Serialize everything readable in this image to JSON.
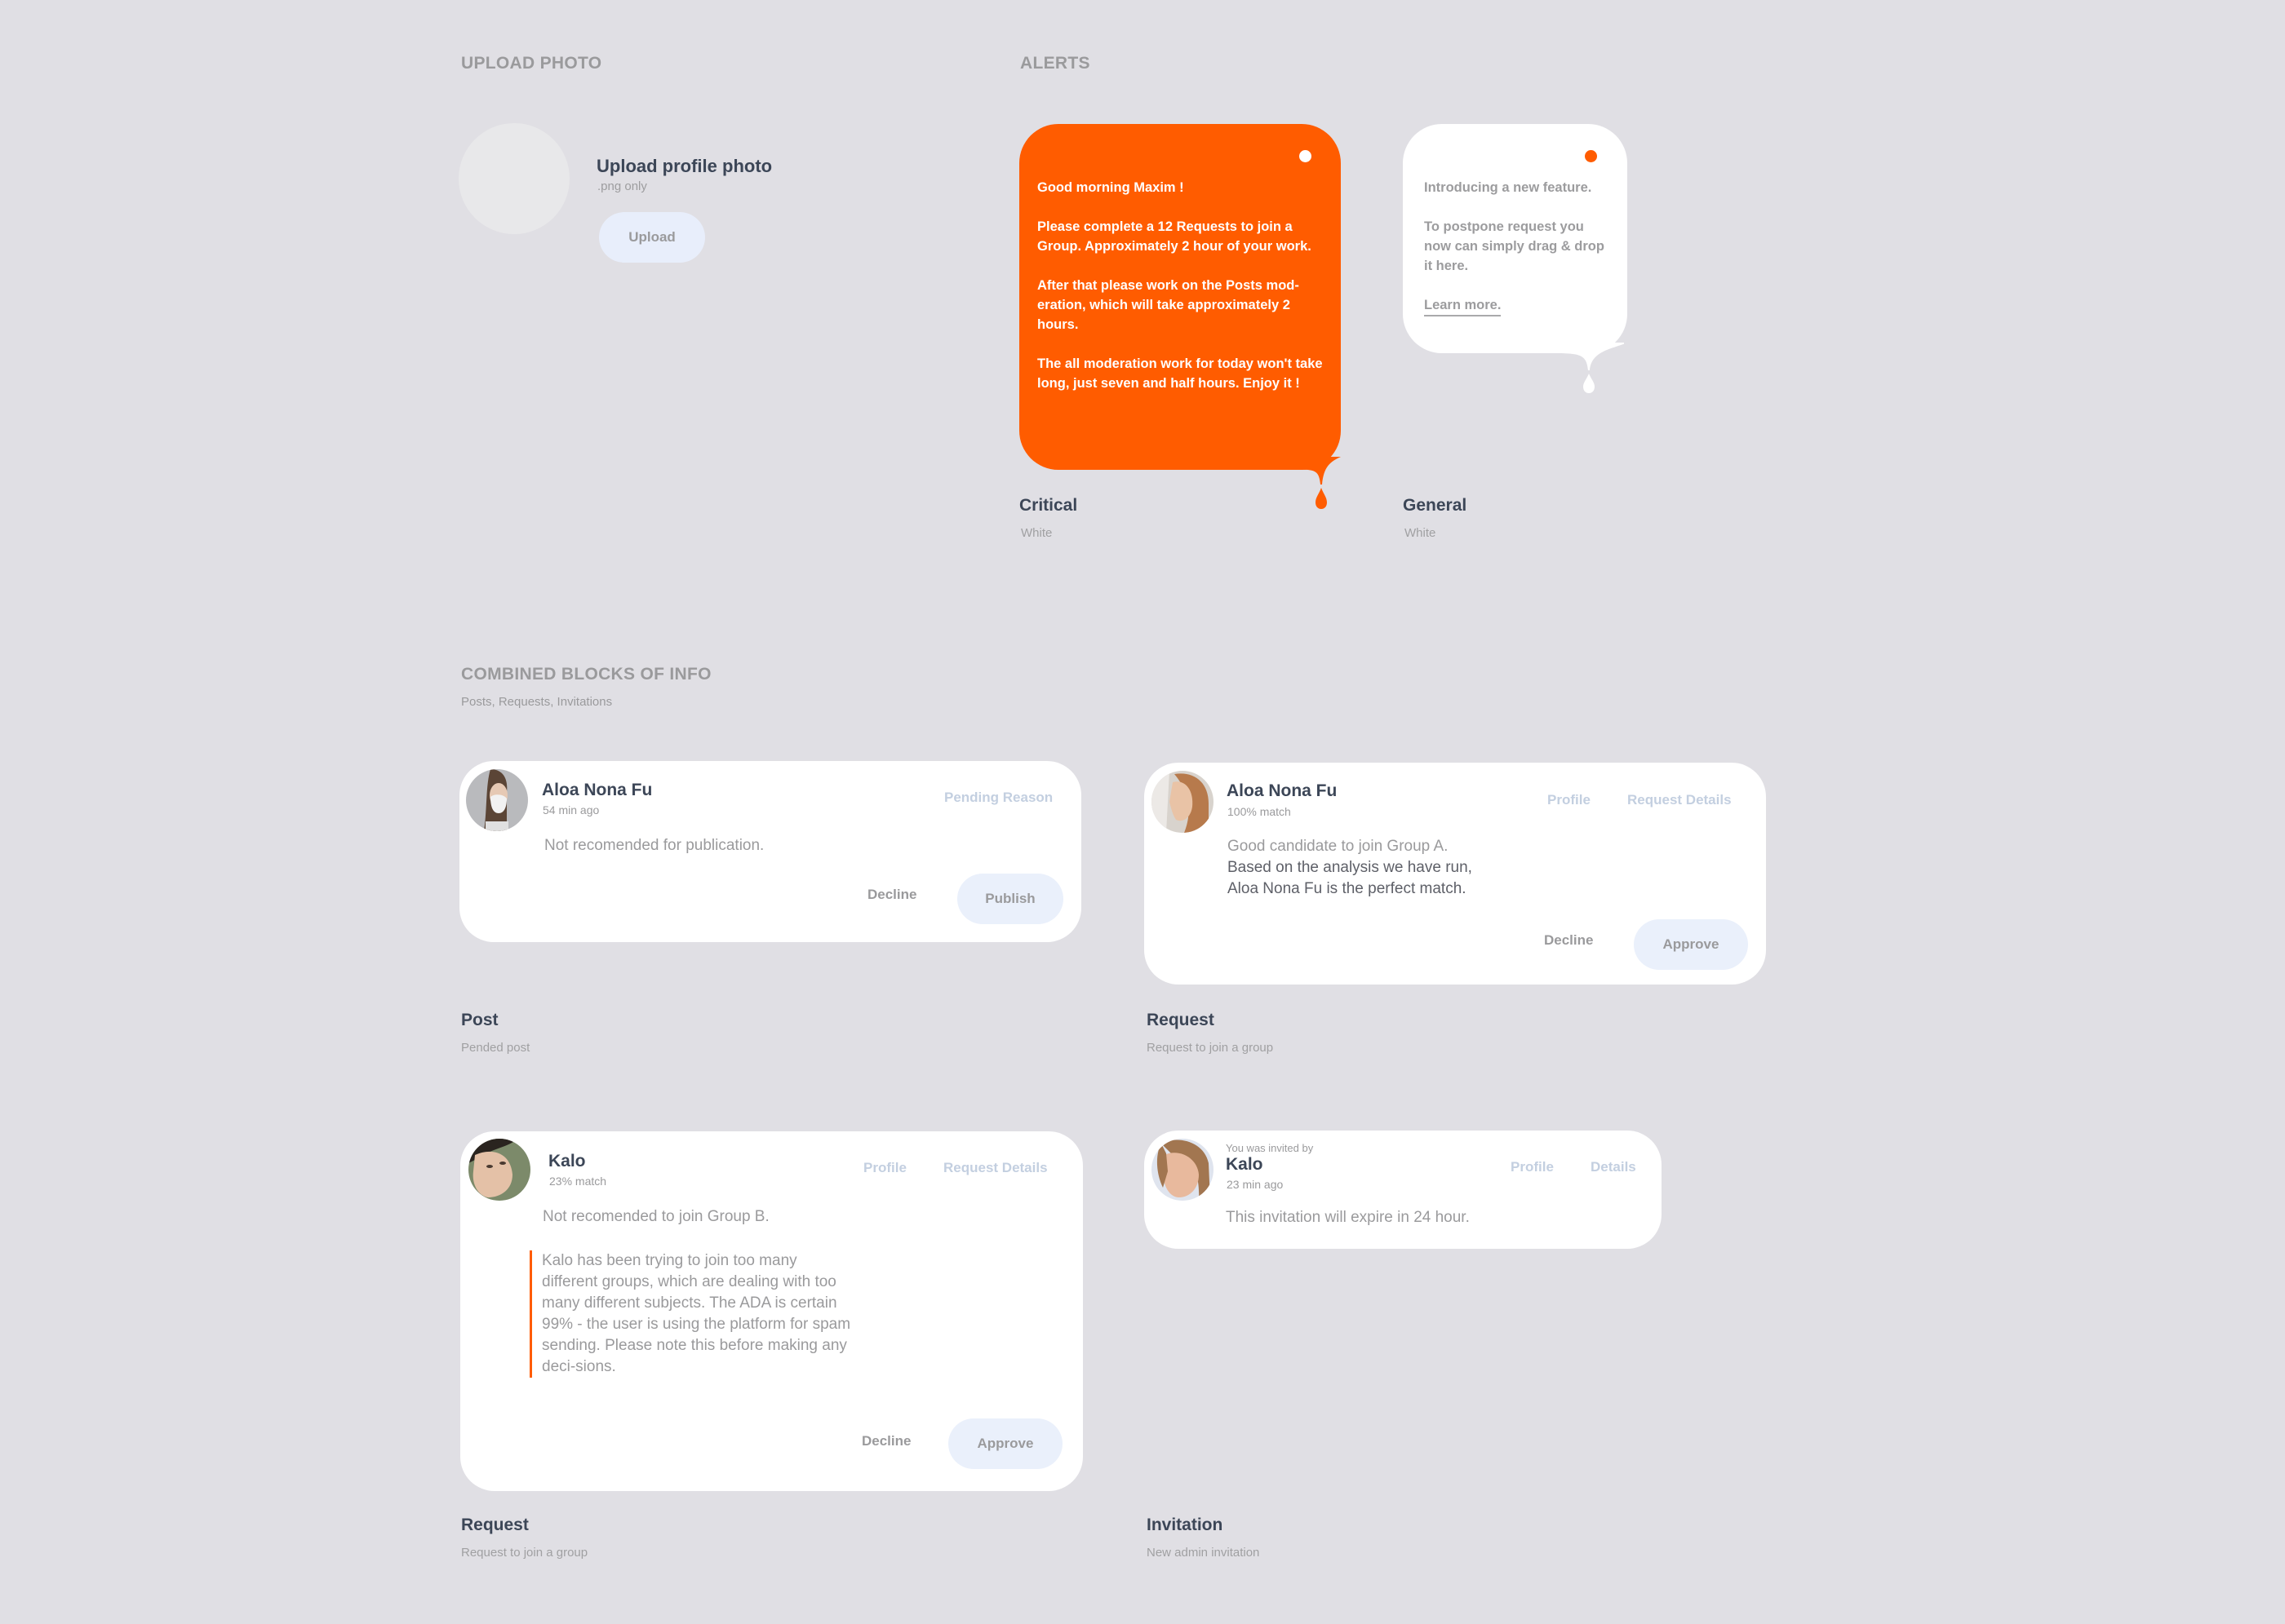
{
  "upload": {
    "section_title": "UPLOAD PHOTO",
    "title": "Upload profile photo",
    "hint": ".png only",
    "button_label": "Upload"
  },
  "alerts": {
    "section_title": "ALERTS",
    "critical": {
      "paragraphs": [
        "Good morning Maxim !",
        "Please complete a 12 Requests to join a Group. Approximately 2 hour of your work.",
        "After that please work on the Posts mod-eration, which will take approximately 2 hours.",
        "The all moderation work for today won't take long, just seven and half hours. Enjoy it !"
      ],
      "label": "Critical",
      "sublabel": "White",
      "color": "#ff5c00"
    },
    "general": {
      "paragraphs": [
        "Introducing a new feature.",
        "To postpone request you now can simply drag & drop it here."
      ],
      "link_label": "Learn more.",
      "label": "General",
      "sublabel": "White"
    }
  },
  "combined": {
    "section_title": "COMBINED BLOCKS OF INFO",
    "subtitle": "Posts, Requests, Invitations",
    "post_card": {
      "name": "Aloa Nona Fu",
      "meta": "54 min ago",
      "link": "Pending Reason",
      "body": "Not recomended for publication.",
      "decline_label": "Decline",
      "primary_label": "Publish",
      "label": "Post",
      "sublabel": "Pended post"
    },
    "request_card_a": {
      "name": "Aloa Nona Fu",
      "meta": "100% match",
      "links": [
        "Profile",
        "Request Details"
      ],
      "body_line1": "Good candidate to join Group A.",
      "body_line2": "Based on the analysis we have run,",
      "body_line3": "Aloa Nona Fu is the perfect match.",
      "decline_label": "Decline",
      "primary_label": "Approve",
      "label": "Request",
      "sublabel": "Request to join a group"
    },
    "request_card_b": {
      "name": "Kalo",
      "meta": "23% match",
      "links": [
        "Profile",
        "Request Details"
      ],
      "body": "Not recomended to join Group B.",
      "quote": "Kalo has been trying to join too many different groups, which are dealing with too many different subjects. The ADA is certain 99% - the user is using the platform for spam sending. Please note this before making any deci-sions.",
      "decline_label": "Decline",
      "primary_label": "Approve",
      "label": "Request",
      "sublabel": "Request to join a group"
    },
    "invitation_card": {
      "pretitle": "You was invited by",
      "name": "Kalo",
      "meta": "23 min ago",
      "links": [
        "Profile",
        "Details"
      ],
      "body": "This invitation will expire in 24 hour.",
      "label": "Invitation",
      "sublabel": "New admin invitation"
    }
  }
}
